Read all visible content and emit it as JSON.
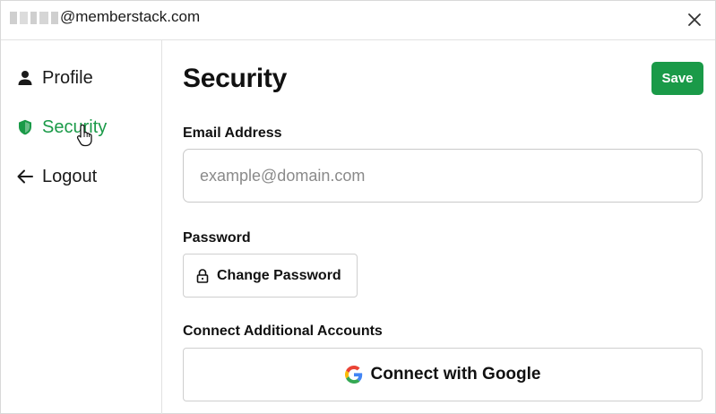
{
  "header": {
    "email_visible": "@memberstack.com",
    "close_icon": "close-icon"
  },
  "sidebar": {
    "items": [
      {
        "label": "Profile",
        "icon": "user-icon",
        "active": false
      },
      {
        "label": "Security",
        "icon": "shield-icon",
        "active": true
      },
      {
        "label": "Logout",
        "icon": "arrow-left-icon",
        "active": false
      }
    ]
  },
  "main": {
    "title": "Security",
    "save_label": "Save",
    "email": {
      "label": "Email Address",
      "value": "",
      "placeholder": "example@domain.com"
    },
    "password": {
      "label": "Password",
      "button_label": "Change Password",
      "icon": "lock-icon"
    },
    "connect": {
      "label": "Connect Additional Accounts",
      "google_label": "Connect with Google",
      "icon": "google-icon"
    }
  },
  "colors": {
    "accent": "#1a9a48",
    "border": "#cfcfcf",
    "text": "#111111"
  }
}
